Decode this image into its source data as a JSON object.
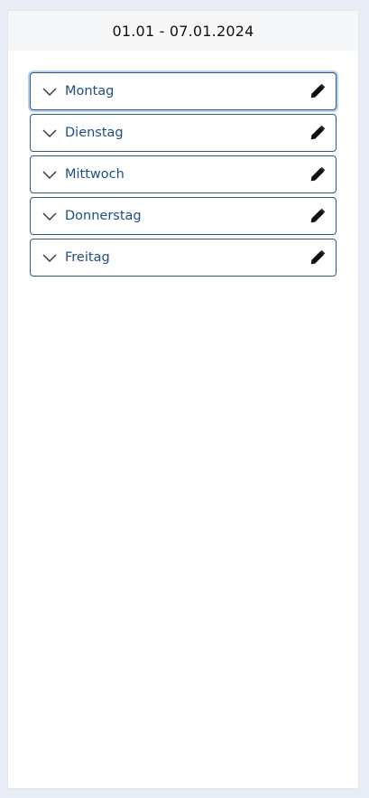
{
  "header": {
    "date_range": "01.01 - 07.01.2024"
  },
  "days": [
    {
      "label": "Montag",
      "icon": "chevron-down-icon",
      "action_icon": "pencil-icon"
    },
    {
      "label": "Dienstag",
      "icon": "chevron-down-icon",
      "action_icon": "pencil-icon"
    },
    {
      "label": "Mittwoch",
      "icon": "chevron-down-icon",
      "action_icon": "pencil-icon"
    },
    {
      "label": "Donnerstag",
      "icon": "chevron-down-icon",
      "action_icon": "pencil-icon"
    },
    {
      "label": "Freitag",
      "icon": "chevron-down-icon",
      "action_icon": "pencil-icon"
    }
  ],
  "colors": {
    "border": "#2c5c8c",
    "label": "#1d4f82",
    "focus_ring": "#b9d1f0",
    "header_bg": "#f6f7f9",
    "page_bg": "#e8edf5"
  }
}
